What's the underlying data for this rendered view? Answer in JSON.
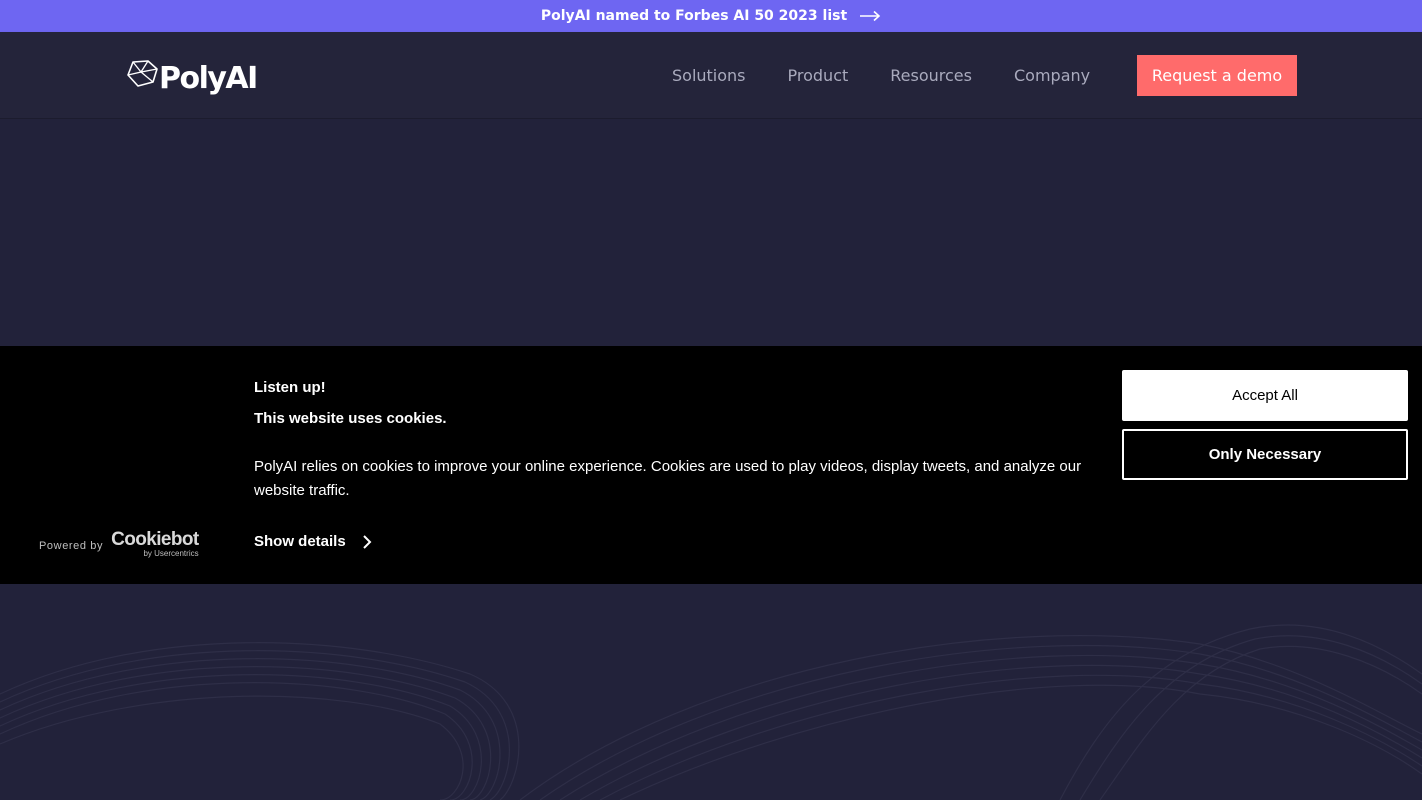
{
  "announcement": {
    "text": "PolyAI named to Forbes AI 50 2023 list",
    "icon": "arrow-right-icon"
  },
  "header": {
    "logo_text": "PolyAI",
    "logo_icon": "polyhedron-icon",
    "nav": [
      "Solutions",
      "Product",
      "Resources",
      "Company"
    ],
    "cta_label": "Request a demo"
  },
  "cookie_banner": {
    "title": "Listen up!",
    "subtitle": "This website uses cookies.",
    "body": "PolyAI relies on cookies to improve your online experience. Cookies are used to play videos, display tweets, and analyze our website traffic.",
    "details_label": "Show details",
    "accept_label": "Accept All",
    "necessary_label": "Only Necessary",
    "powered_by": "Powered by",
    "brand": "Cookiebot",
    "brand_sub": "by Usercentrics"
  },
  "colors": {
    "announcement_bg": "#6e66f2",
    "page_bg": "#22223a",
    "cta_bg": "#ff6b6b",
    "banner_bg": "#000000"
  }
}
